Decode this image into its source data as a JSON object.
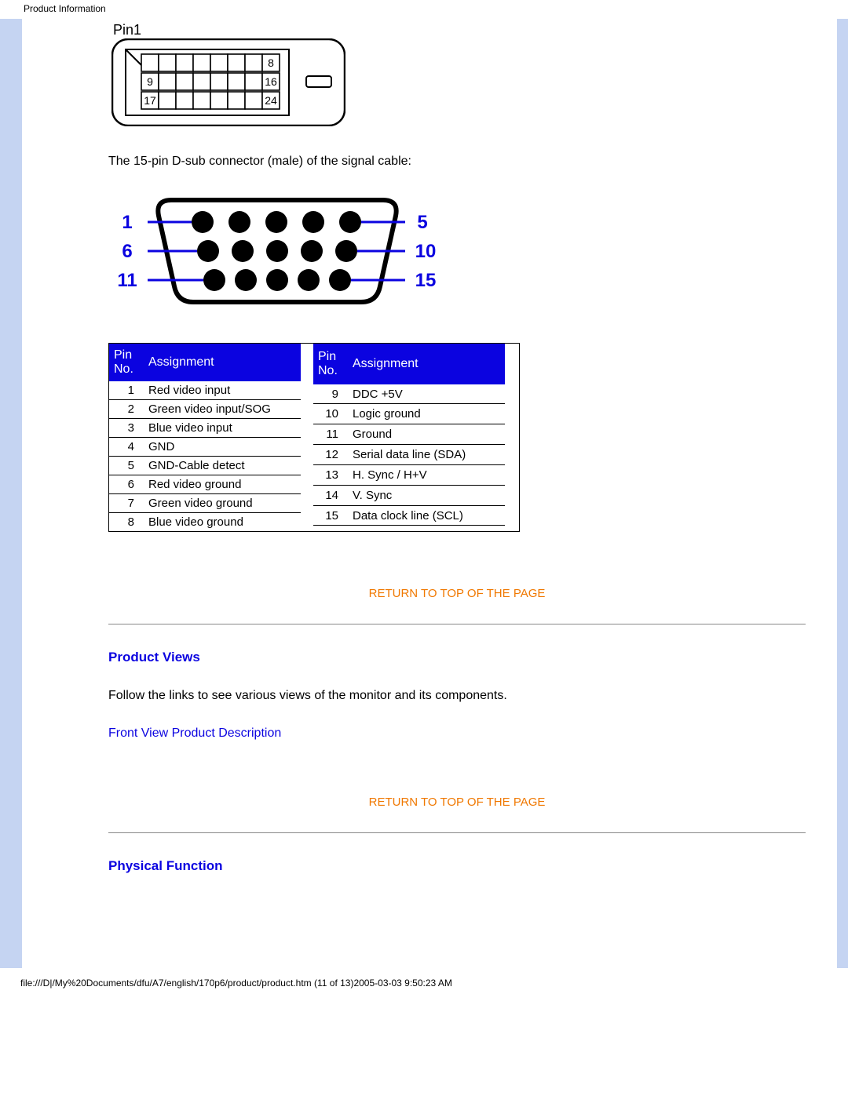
{
  "header": {
    "title": "Product Information"
  },
  "dvi": {
    "pin1_label": "Pin1",
    "small_labels": {
      "r1": "8",
      "r2a": "9",
      "r2b": "16",
      "r3a": "17",
      "r3b": "24"
    }
  },
  "dsub": {
    "caption": "The 15-pin D-sub connector (male) of the signal cable:",
    "left": {
      "a": "1",
      "b": "6",
      "c": "11"
    },
    "right": {
      "a": "5",
      "b": "10",
      "c": "15"
    }
  },
  "pin_table": {
    "headers": {
      "pin": "Pin No.",
      "assign": "Assignment"
    },
    "left": [
      {
        "pin": "1",
        "assign": "Red video input"
      },
      {
        "pin": "2",
        "assign": "Green video input/SOG"
      },
      {
        "pin": "3",
        "assign": "Blue video input"
      },
      {
        "pin": "4",
        "assign": "GND"
      },
      {
        "pin": "5",
        "assign": "GND-Cable detect"
      },
      {
        "pin": "6",
        "assign": "Red video ground"
      },
      {
        "pin": "7",
        "assign": "Green video ground"
      },
      {
        "pin": "8",
        "assign": "Blue video ground"
      }
    ],
    "right": [
      {
        "pin": "9",
        "assign": "DDC +5V"
      },
      {
        "pin": "10",
        "assign": "Logic ground"
      },
      {
        "pin": "11",
        "assign": "Ground"
      },
      {
        "pin": "12",
        "assign": "Serial data line (SDA)"
      },
      {
        "pin": "13",
        "assign": "H. Sync / H+V"
      },
      {
        "pin": "14",
        "assign": "V. Sync"
      },
      {
        "pin": "15",
        "assign": "Data clock line (SCL)"
      },
      {
        "pin": "",
        "assign": ""
      }
    ]
  },
  "links": {
    "return_top": "RETURN TO TOP OF THE PAGE",
    "front_view": "Front View Product Description"
  },
  "sections": {
    "product_views": "Product Views",
    "product_views_text": "Follow the links to see various views of the monitor and its components.",
    "physical_function": "Physical Function"
  },
  "footer": {
    "path": "file:///D|/My%20Documents/dfu/A7/english/170p6/product/product.htm (11 of 13)2005-03-03 9:50:23 AM"
  }
}
